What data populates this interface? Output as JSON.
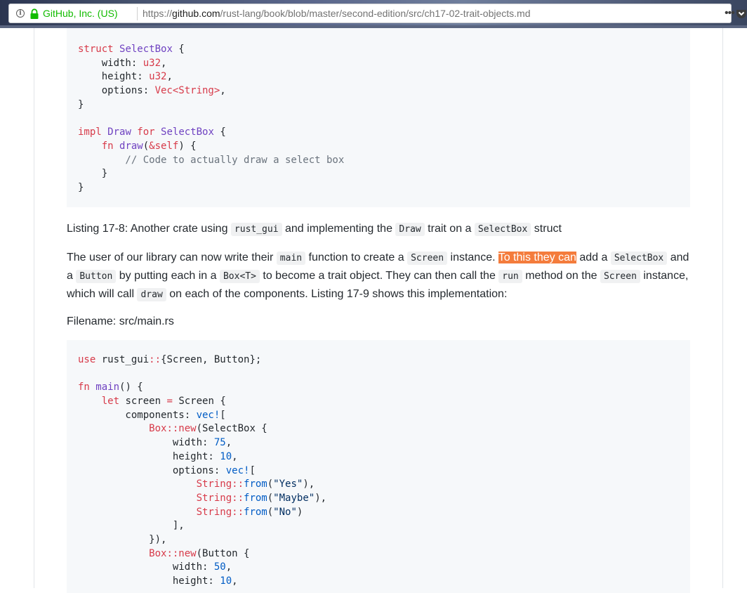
{
  "browser": {
    "identity": "GitHub, Inc. (US)",
    "url_scheme": "https://",
    "url_host": "github.com",
    "url_path": "/rust-lang/book/blob/master/second-edition/src/ch17-02-trait-objects.md",
    "menu_glyph": "•••"
  },
  "code1": {
    "lines": [
      [
        [
          "struct ",
          "k"
        ],
        [
          "SelectBox",
          "e"
        ],
        [
          " {",
          ""
        ]
      ],
      [
        [
          "    width: ",
          ""
        ],
        [
          "u32",
          "k"
        ],
        [
          ",",
          ""
        ]
      ],
      [
        [
          "    height: ",
          ""
        ],
        [
          "u32",
          "k"
        ],
        [
          ",",
          ""
        ]
      ],
      [
        [
          "    options: ",
          ""
        ],
        [
          "Vec<String>",
          "k"
        ],
        [
          ",",
          ""
        ]
      ],
      [
        [
          "}",
          ""
        ]
      ],
      [
        [
          "",
          ""
        ]
      ],
      [
        [
          "impl ",
          "k"
        ],
        [
          "Draw",
          "e"
        ],
        [
          " for ",
          "k"
        ],
        [
          "SelectBox",
          "e"
        ],
        [
          " {",
          ""
        ]
      ],
      [
        [
          "    ",
          ""
        ],
        [
          "fn ",
          "k"
        ],
        [
          "draw",
          "e"
        ],
        [
          "(",
          ""
        ],
        [
          "&self",
          "k"
        ],
        [
          ") {",
          ""
        ]
      ],
      [
        [
          "        // Code to actually draw a select box",
          "c"
        ]
      ],
      [
        [
          "    }",
          ""
        ]
      ],
      [
        [
          "}",
          ""
        ]
      ]
    ]
  },
  "caption": {
    "t1": "Listing 17-8: Another crate using ",
    "c1": "rust_gui",
    "t2": " and implementing the ",
    "c2": "Draw",
    "t3": " trait on a ",
    "c3": "SelectBox",
    "t4": " struct"
  },
  "body_para": {
    "t1": "The user of our library can now write their ",
    "c1": "main",
    "t2": " function to create a ",
    "c2": "Screen",
    "t3": " instance. ",
    "highlight": "To this they can",
    "t4": " add a ",
    "c3": "SelectBox",
    "t5": " and a ",
    "c4": "Button",
    "t6": " by putting each in a ",
    "c5": "Box<T>",
    "t7": " to become a trait object. They can then call the ",
    "c6": "run",
    "t8": " method on the ",
    "c7": "Screen",
    "t9": " instance, which will call ",
    "c8": "draw",
    "t10": " on each of the components. Listing 17-9 shows this implementation:"
  },
  "filename_label": "Filename: src/main.rs",
  "code2": {
    "lines": [
      [
        [
          "use ",
          "k"
        ],
        [
          "rust_gui",
          ""
        ],
        [
          "::",
          "k"
        ],
        [
          "{Screen, Button};",
          ""
        ]
      ],
      [
        [
          "",
          ""
        ]
      ],
      [
        [
          "fn ",
          "k"
        ],
        [
          "main",
          "e"
        ],
        [
          "() {",
          ""
        ]
      ],
      [
        [
          "    ",
          ""
        ],
        [
          "let ",
          "k"
        ],
        [
          "screen ",
          ""
        ],
        [
          "= ",
          "k"
        ],
        [
          "Screen {",
          ""
        ]
      ],
      [
        [
          "        components: ",
          ""
        ],
        [
          "vec!",
          "n"
        ],
        [
          "[",
          ""
        ]
      ],
      [
        [
          "            ",
          ""
        ],
        [
          "Box::new",
          "k"
        ],
        [
          "(SelectBox {",
          ""
        ]
      ],
      [
        [
          "                width: ",
          ""
        ],
        [
          "75",
          "n"
        ],
        [
          ",",
          ""
        ]
      ],
      [
        [
          "                height: ",
          ""
        ],
        [
          "10",
          "n"
        ],
        [
          ",",
          ""
        ]
      ],
      [
        [
          "                options: ",
          ""
        ],
        [
          "vec!",
          "n"
        ],
        [
          "[",
          ""
        ]
      ],
      [
        [
          "                    ",
          ""
        ],
        [
          "String::",
          "k"
        ],
        [
          "from",
          "n"
        ],
        [
          "(",
          ""
        ],
        [
          "\"Yes\"",
          "s"
        ],
        [
          "),",
          ""
        ]
      ],
      [
        [
          "                    ",
          ""
        ],
        [
          "String::",
          "k"
        ],
        [
          "from",
          "n"
        ],
        [
          "(",
          ""
        ],
        [
          "\"Maybe\"",
          "s"
        ],
        [
          "),",
          ""
        ]
      ],
      [
        [
          "                    ",
          ""
        ],
        [
          "String::",
          "k"
        ],
        [
          "from",
          "n"
        ],
        [
          "(",
          ""
        ],
        [
          "\"No\"",
          "s"
        ],
        [
          ")",
          ""
        ]
      ],
      [
        [
          "                ],",
          ""
        ]
      ],
      [
        [
          "            }),",
          ""
        ]
      ],
      [
        [
          "            ",
          ""
        ],
        [
          "Box::new",
          "k"
        ],
        [
          "(Button {",
          ""
        ]
      ],
      [
        [
          "                width: ",
          ""
        ],
        [
          "50",
          "n"
        ],
        [
          ",",
          ""
        ]
      ],
      [
        [
          "                height: ",
          ""
        ],
        [
          "10",
          "n"
        ],
        [
          ",",
          ""
        ]
      ]
    ]
  }
}
